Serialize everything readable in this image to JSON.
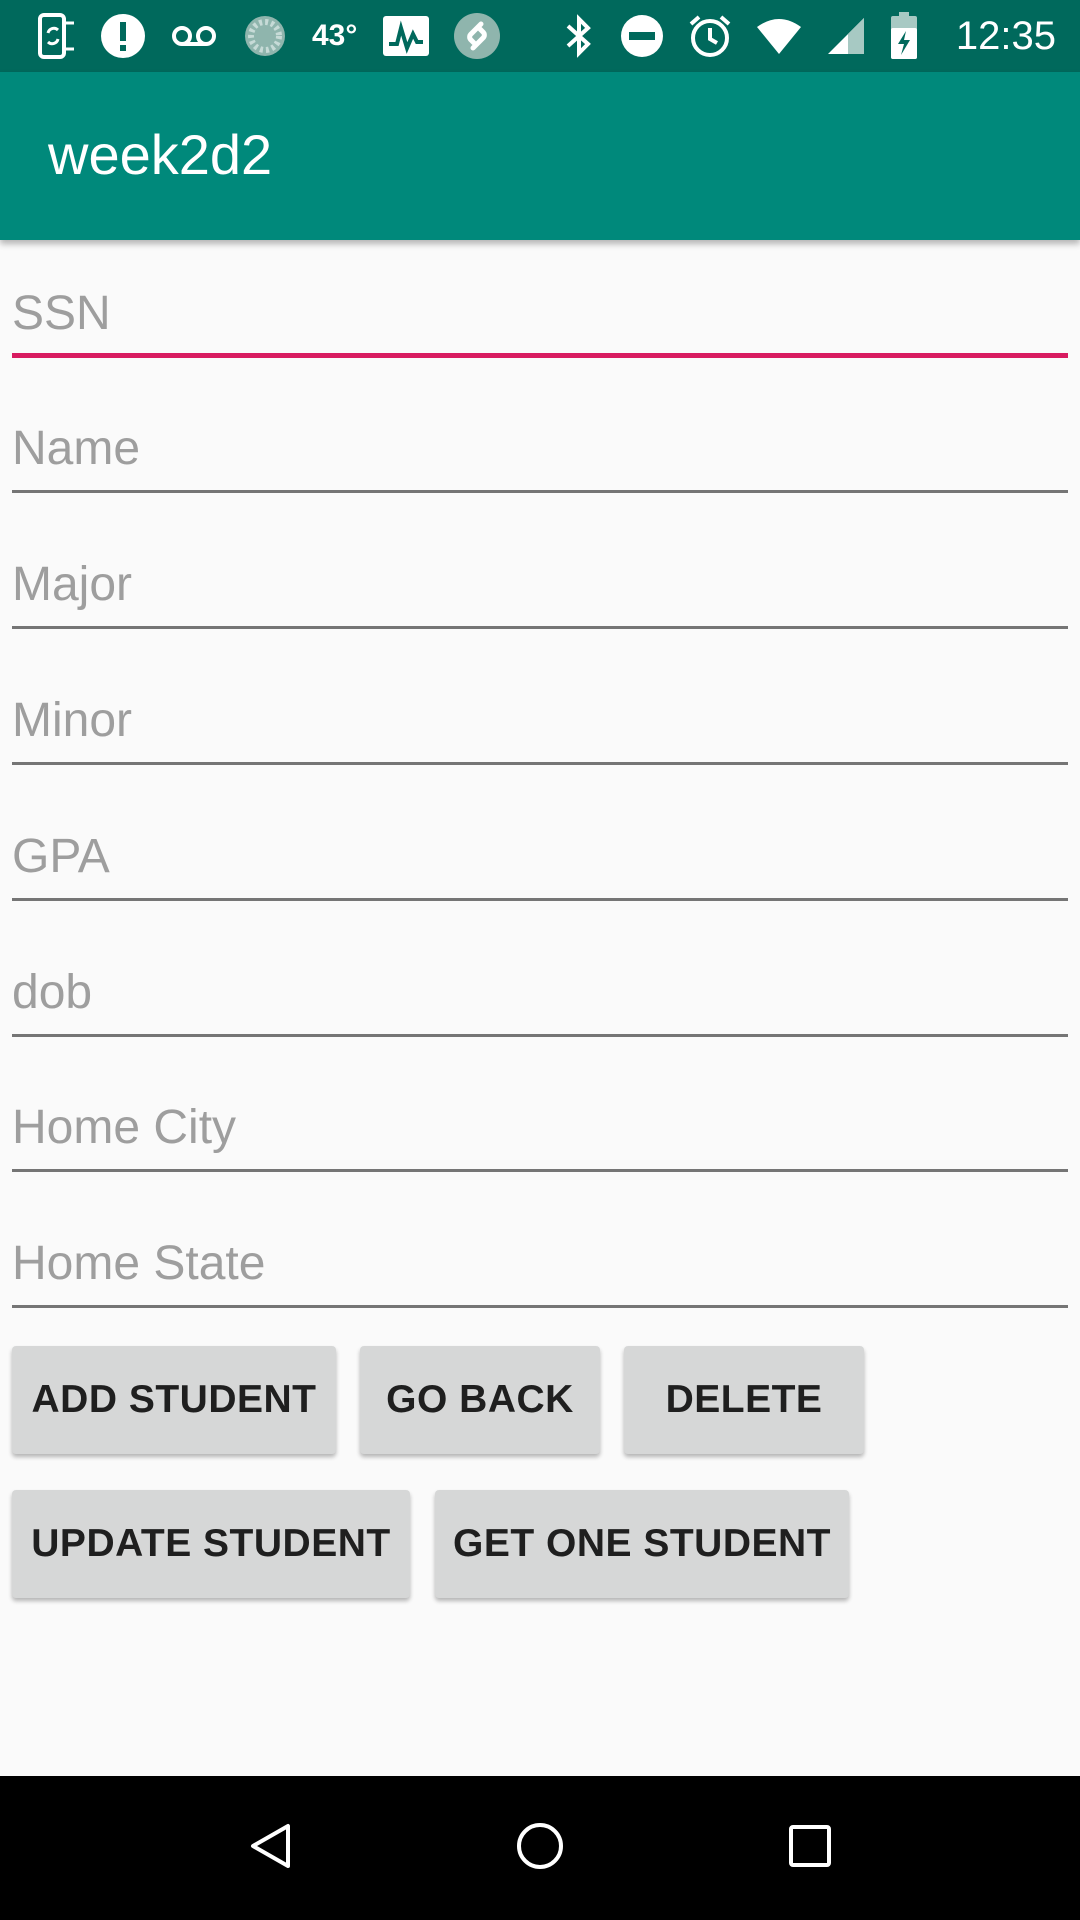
{
  "status_bar": {
    "temperature": "43°",
    "time": "12:35",
    "icons_left": [
      "phone-sync-icon",
      "alert-icon",
      "voicemail-icon",
      "loading-icon",
      "temperature-text",
      "activity-chart-icon",
      "shazam-icon"
    ],
    "icons_right": [
      "bluetooth-icon",
      "do-not-disturb-icon",
      "alarm-icon",
      "wifi-icon",
      "cellular-signal-icon",
      "battery-charging-icon"
    ]
  },
  "app_bar": {
    "title": "week2d2"
  },
  "form": {
    "fields": [
      {
        "placeholder": "SSN",
        "value": "",
        "focused": true
      },
      {
        "placeholder": "Name",
        "value": ""
      },
      {
        "placeholder": "Major",
        "value": ""
      },
      {
        "placeholder": "Minor",
        "value": ""
      },
      {
        "placeholder": "GPA",
        "value": ""
      },
      {
        "placeholder": "dob",
        "value": ""
      },
      {
        "placeholder": "Home City",
        "value": ""
      },
      {
        "placeholder": "Home State",
        "value": ""
      }
    ]
  },
  "buttons": {
    "add_student": "ADD STUDENT",
    "go_back": "GO BACK",
    "delete": "DELETE",
    "update_student": "UPDATE STUDENT",
    "get_one_student": "GET ONE STUDENT"
  },
  "nav_bar": {
    "icons": [
      "back-icon",
      "home-icon",
      "recents-icon"
    ]
  },
  "colors": {
    "status_bar": "#00695c",
    "app_bar": "#00897b",
    "accent": "#d81b60",
    "background": "#fafafa",
    "button": "#d6d7d7"
  }
}
